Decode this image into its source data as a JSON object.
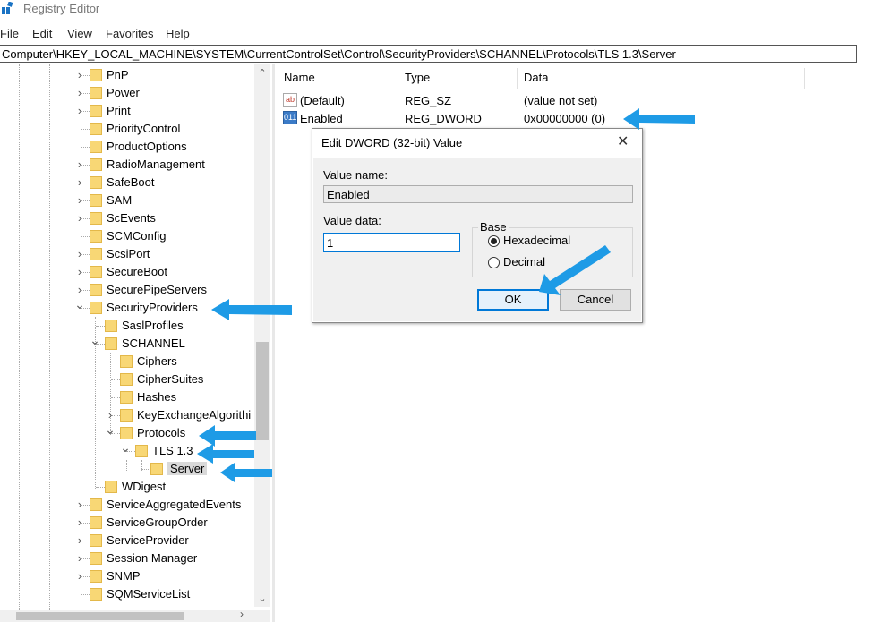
{
  "window": {
    "title": "Registry Editor"
  },
  "menu": [
    "File",
    "Edit",
    "View",
    "Favorites",
    "Help"
  ],
  "address": "Computer\\HKEY_LOCAL_MACHINE\\SYSTEM\\CurrentControlSet\\Control\\SecurityProviders\\SCHANNEL\\Protocols\\TLS 1.3\\Server",
  "tree": {
    "items": [
      {
        "label": "PnP",
        "chev": ">"
      },
      {
        "label": "Power",
        "chev": ">"
      },
      {
        "label": "Print",
        "chev": ">"
      },
      {
        "label": "PriorityControl",
        "chev": ""
      },
      {
        "label": "ProductOptions",
        "chev": ""
      },
      {
        "label": "RadioManagement",
        "chev": ">"
      },
      {
        "label": "SafeBoot",
        "chev": ">"
      },
      {
        "label": "SAM",
        "chev": ">"
      },
      {
        "label": "ScEvents",
        "chev": ">"
      },
      {
        "label": "SCMConfig",
        "chev": ""
      },
      {
        "label": "ScsiPort",
        "chev": ">"
      },
      {
        "label": "SecureBoot",
        "chev": ">"
      },
      {
        "label": "SecurePipeServers",
        "chev": ">"
      },
      {
        "label": "SecurityProviders",
        "chev": "v"
      },
      {
        "label": "SaslProfiles",
        "chev": ""
      },
      {
        "label": "SCHANNEL",
        "chev": "v"
      },
      {
        "label": "Ciphers",
        "chev": ""
      },
      {
        "label": "CipherSuites",
        "chev": ""
      },
      {
        "label": "Hashes",
        "chev": ""
      },
      {
        "label": "KeyExchangeAlgorithi",
        "chev": ">"
      },
      {
        "label": "Protocols",
        "chev": "v"
      },
      {
        "label": "TLS 1.3",
        "chev": "v"
      },
      {
        "label": "Server",
        "chev": ""
      },
      {
        "label": "WDigest",
        "chev": ""
      },
      {
        "label": "ServiceAggregatedEvents",
        "chev": ">"
      },
      {
        "label": "ServiceGroupOrder",
        "chev": ">"
      },
      {
        "label": "ServiceProvider",
        "chev": ">"
      },
      {
        "label": "Session Manager",
        "chev": ">"
      },
      {
        "label": "SNMP",
        "chev": ">"
      },
      {
        "label": "SQMServiceList",
        "chev": ""
      }
    ]
  },
  "list": {
    "headers": [
      "Name",
      "Type",
      "Data"
    ],
    "rows": [
      {
        "icon": "ab",
        "name": "(Default)",
        "type": "REG_SZ",
        "data": "(value not set)"
      },
      {
        "icon": "011",
        "name": "Enabled",
        "type": "REG_DWORD",
        "data": "0x00000000 (0)"
      }
    ]
  },
  "dialog": {
    "title": "Edit DWORD (32-bit) Value",
    "close": "✕",
    "value_name_label": "Value name:",
    "value_name": "Enabled",
    "value_data_label": "Value data:",
    "value_data": "1",
    "base_label": "Base",
    "radio_hex": "Hexadecimal",
    "radio_dec": "Decimal",
    "ok": "OK",
    "cancel": "Cancel"
  },
  "colors": {
    "arrow": "#1e9be6",
    "folder": "#f8d775",
    "accent": "#0078d7"
  }
}
